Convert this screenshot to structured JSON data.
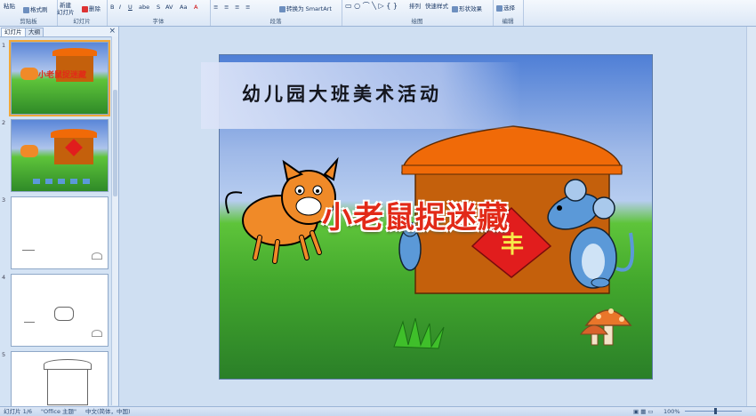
{
  "ribbon": {
    "clipboard": {
      "paste": "粘贴",
      "format_painter": "格式刷",
      "label": "剪贴板"
    },
    "slides": {
      "new_slide_l1": "新建",
      "new_slide_l2": "幻灯片",
      "delete": "删除",
      "label": "幻灯片"
    },
    "font": {
      "label": "字体"
    },
    "paragraph": {
      "convert_smartart": "转换为 SmartArt",
      "label": "段落"
    },
    "drawing": {
      "arrange": "排列",
      "quick_styles": "快速样式",
      "shape_effects": "形状效果",
      "label": "绘图"
    },
    "editing": {
      "select": "选择",
      "label": "编辑"
    }
  },
  "pane": {
    "tab_slides": "幻灯片",
    "tab_outline": "大纲",
    "close": "×",
    "thumbnails": [
      {
        "num": "1",
        "selected": true
      },
      {
        "num": "2"
      },
      {
        "num": "3"
      },
      {
        "num": "4"
      },
      {
        "num": "5"
      }
    ]
  },
  "slide": {
    "title": "幼儿园大班美术活动",
    "big_title": "小老鼠捉迷藏",
    "door_char": "丰"
  },
  "status": {
    "slide_info": "幻灯片 1/6",
    "theme": "\"Office 主题\"",
    "language": "中文(简体，中国)",
    "zoom": "100%"
  },
  "colors": {
    "house_roof": "#f06a08",
    "house_wall": "#c4600c",
    "door": "#e11d1d",
    "mouse": "#5b99d8",
    "cat": "#f08a28"
  }
}
